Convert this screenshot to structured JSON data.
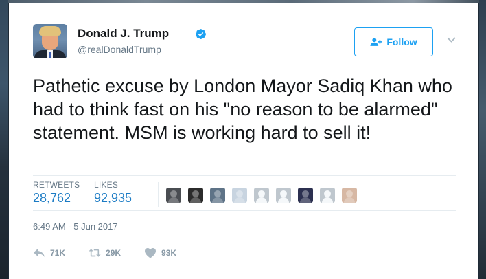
{
  "user": {
    "name": "Donald J. Trump",
    "handle": "@realDonaldTrump",
    "verified_icon": "verified-badge-icon"
  },
  "follow": {
    "label": "Follow",
    "icon": "add-user-icon"
  },
  "more_icon": "chevron-down-icon",
  "tweet": {
    "text": "Pathetic excuse by London Mayor Sadiq Khan who had to think fast on his \"no reason to be alarmed\" statement. MSM is working hard to sell it!"
  },
  "stats": {
    "retweets_label": "RETWEETS",
    "retweets_value": "28,762",
    "likes_label": "LIKES",
    "likes_value": "92,935"
  },
  "likers": [
    {
      "color": "#4a4d52"
    },
    {
      "color": "#2b2b2b"
    },
    {
      "color": "#5e7387"
    },
    {
      "color": "#c8d4e0"
    },
    {
      "color": "#bfc7ce"
    },
    {
      "color": "#bfc7ce"
    },
    {
      "color": "#2c3050"
    },
    {
      "color": "#bfc7ce"
    },
    {
      "color": "#d7b8a4"
    }
  ],
  "timestamp": "6:49 AM - 5 Jun 2017",
  "actions": {
    "reply_count": "71K",
    "retweet_count": "29K",
    "like_count": "93K"
  },
  "colors": {
    "accent": "#1da1f2",
    "stat_value": "#1b7bc4",
    "muted": "#657786"
  }
}
